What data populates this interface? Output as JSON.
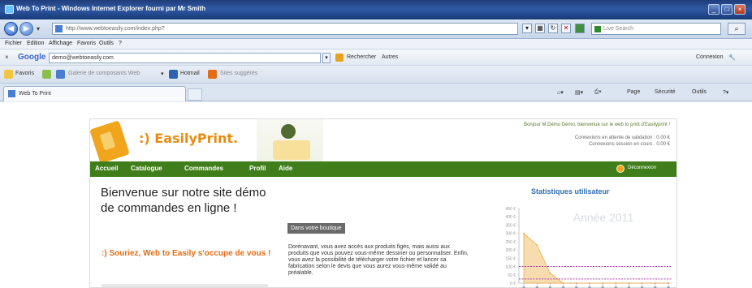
{
  "window": {
    "title": "Web To Print - Windows Internet Explorer fourni par Mr Smith"
  },
  "address_bar": {
    "url": "http://www.webtoeasily.com/index.php?",
    "search_placeholder": "Live Search"
  },
  "menu": [
    "Fichier",
    "Edition",
    "Affichage",
    "Favoris",
    "Outils",
    "?"
  ],
  "google_toolbar": {
    "logo": "Google",
    "query": "demo@webtoeasily.com",
    "search_label": "Rechercher",
    "more_label": "Autres",
    "signin_label": "Connexion"
  },
  "favorites_bar": {
    "favorites_label": "Favoris",
    "link1": "Galerie de composants Web",
    "link2": "Hotmail",
    "link3": "Sites suggérés"
  },
  "tabs": {
    "active_tab": "Web To Print",
    "commands": {
      "page": "Page",
      "security": "Sécurité",
      "tools": "Outils"
    }
  },
  "site": {
    "logo_text": ":) EasilyPrint.",
    "welcome_user": "Bonjour M.Démo Démo, bienvenue sur le web to print d'Easilyprint !",
    "stat_connexions_wait": "Connexions en attente de validation : 0.00 €",
    "stat_connexions_session": "Connexions session en cours : 0.00 €",
    "nav": [
      "Accueil",
      "Catalogue",
      "Commandes",
      "Profil",
      "Aide"
    ],
    "logout": "Déconnexion",
    "welcome_heading": "Bienvenue sur notre site démo de commandes en ligne !",
    "slogan": ":) Souriez, Web to Easily s'occupe de vous !",
    "shop_button": "Dans votre boutique",
    "description": "Dorénavant, vous avez accès aux produits figés, mais aussi aux produits que vous pouvez vous-même dessiner ou personnaliser. Enfin, vous avez la possibilité de télécharger votre fichier et lancer sa fabrication selon le devis que vous aurez vous-même validé au préalable.",
    "stats_title": "Statistiques utilisateur"
  },
  "chart_data": {
    "type": "area",
    "title": "Année 2011",
    "y_ticks": [
      "450 €",
      "400 €",
      "350 €",
      "300 €",
      "250 €",
      "200 €",
      "150 €",
      "100 €",
      "50 €",
      "0 €"
    ],
    "ylim": [
      0,
      450
    ],
    "series": [
      {
        "values": [
          300,
          230,
          60,
          0,
          0,
          0,
          0,
          0,
          0,
          0,
          0,
          0
        ],
        "color": "#f5a623"
      }
    ],
    "reference_lines": [
      {
        "y": 100,
        "color": "#b03ab0"
      },
      {
        "y": 25,
        "color": "#b03ab0"
      }
    ],
    "colors": {
      "fill": "#f7d9a8",
      "stroke": "#f0a030"
    }
  }
}
